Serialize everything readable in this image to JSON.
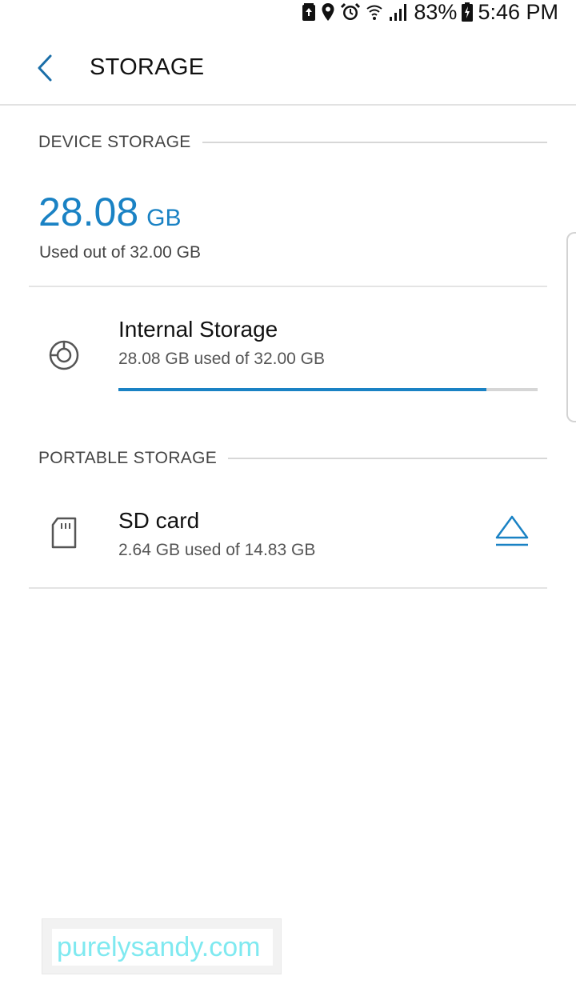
{
  "status_bar": {
    "battery_percent": "83%",
    "time": "5:46 PM",
    "icons": [
      "battery-saver-icon",
      "location-icon",
      "alarm-icon",
      "wifi-icon",
      "signal-icon",
      "battery-icon"
    ]
  },
  "header": {
    "title": "STORAGE",
    "back_icon": "chevron-left-icon"
  },
  "device_storage": {
    "section_label": "DEVICE STORAGE",
    "used_value": "28.08",
    "used_unit": "GB",
    "used_summary": "Used out of 32.00 GB",
    "items": [
      {
        "icon": "pie-chart-icon",
        "title": "Internal Storage",
        "subtitle": "28.08 GB used of 32.00 GB",
        "usage_fraction": 0.8775
      }
    ]
  },
  "portable_storage": {
    "section_label": "PORTABLE STORAGE",
    "items": [
      {
        "icon": "sd-card-icon",
        "title": "SD card",
        "subtitle": "2.64 GB used of 14.83 GB",
        "action_icon": "eject-icon"
      }
    ]
  },
  "watermark": {
    "text": "purelysandy.com"
  },
  "colors": {
    "accent": "#1a82c4",
    "watermark": "#7fe9f0",
    "divider": "#e4e4e4"
  }
}
